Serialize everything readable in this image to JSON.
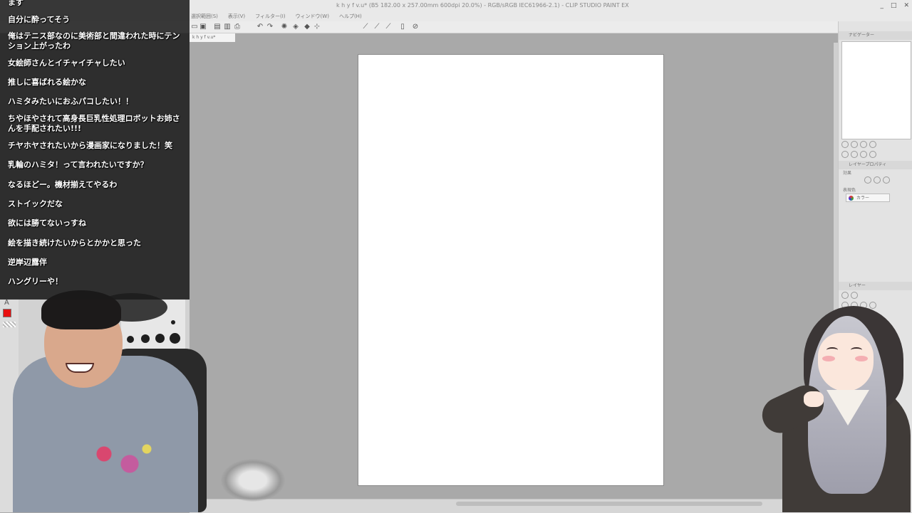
{
  "window": {
    "title": "k h y f v.u* (B5 182.00 x 257.00mm 600dpi 20.0%) - RGB/sRGB IEC61966-2.1) - CLIP STUDIO PAINT EX",
    "minimize": "_",
    "maximize": "□",
    "close": "✕"
  },
  "menubar": {
    "items": [
      "選択範囲(S)",
      "表示(V)",
      "フィルター(I)",
      "ウィンドウ(W)",
      "ヘルプ(H)"
    ]
  },
  "document": {
    "tab_label": "k h y f v.u*"
  },
  "right_panel": {
    "navigator_header": "ナビゲーター",
    "layer_property_header": "レイヤープロパティ",
    "effect_label": "効果",
    "expression_color_label": "表現色",
    "color_select_value": "カラー",
    "layer_header": "レイヤー"
  },
  "left_tools": {
    "tool_letter": "A",
    "active_color": "#e81010"
  },
  "chat": {
    "messages": [
      "ます",
      "自分に酔ってそう",
      "俺はテニス部なのに美術部と間違われた時にテンション上がったわ",
      "女絵師さんとイチャイチャしたい",
      "推しに喜ばれる絵かな",
      "ハミタみたいにおふパコしたい！！",
      "ちやほやされて高身長巨乳性処理ロボットお姉さんを手配されたい!!!",
      "チヤホヤされたいから漫画家になりました！笑",
      "乳輪のハミタ！って言われたいですか？",
      "なるほどー。機材揃えてやるわ",
      "ストイックだな",
      "欲には勝てないっすね",
      "絵を描き続けたいからとかかと思った",
      "逆岸辺露伴",
      "ハングリーや！"
    ]
  },
  "colors": {
    "canvas_bg": "#a9a9a9",
    "page": "#ffffff",
    "chat_bg": "#1a1a1a"
  }
}
